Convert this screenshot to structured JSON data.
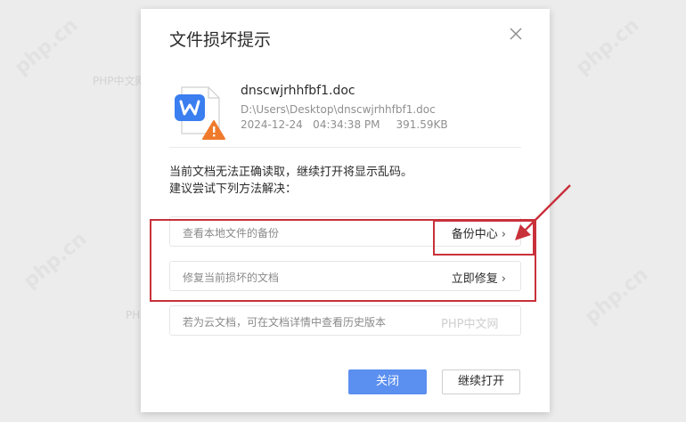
{
  "dialog": {
    "title": "文件损坏提示",
    "file": {
      "name": "dnscwjrhhfbf1.doc",
      "path": "D:\\Users\\Desktop\\dnscwjrhhfbf1.doc",
      "datetime": "2024-12-24   04:34:38 PM",
      "size": "391.59KB"
    },
    "message_line1": "当前文档无法正确读取，继续打开将显示乱码。",
    "message_line2": "建议尝试下列方法解决：",
    "options": [
      {
        "label": "查看本地文件的备份",
        "action": "备份中心"
      },
      {
        "label": "修复当前损坏的文档",
        "action": "立即修复"
      },
      {
        "label": "若为云文档，可在文档详情中查看历史版本",
        "action": ""
      }
    ],
    "buttons": {
      "close": "关闭",
      "continue": "继续打开"
    }
  },
  "watermark": "PHP中文网",
  "watermark_rot": "php.cn",
  "colors": {
    "primary_button": "#5b8ff0",
    "annotation_red": "#c8313a",
    "file_icon_blue": "#3a7ef0",
    "warning_orange": "#f07a2b"
  }
}
